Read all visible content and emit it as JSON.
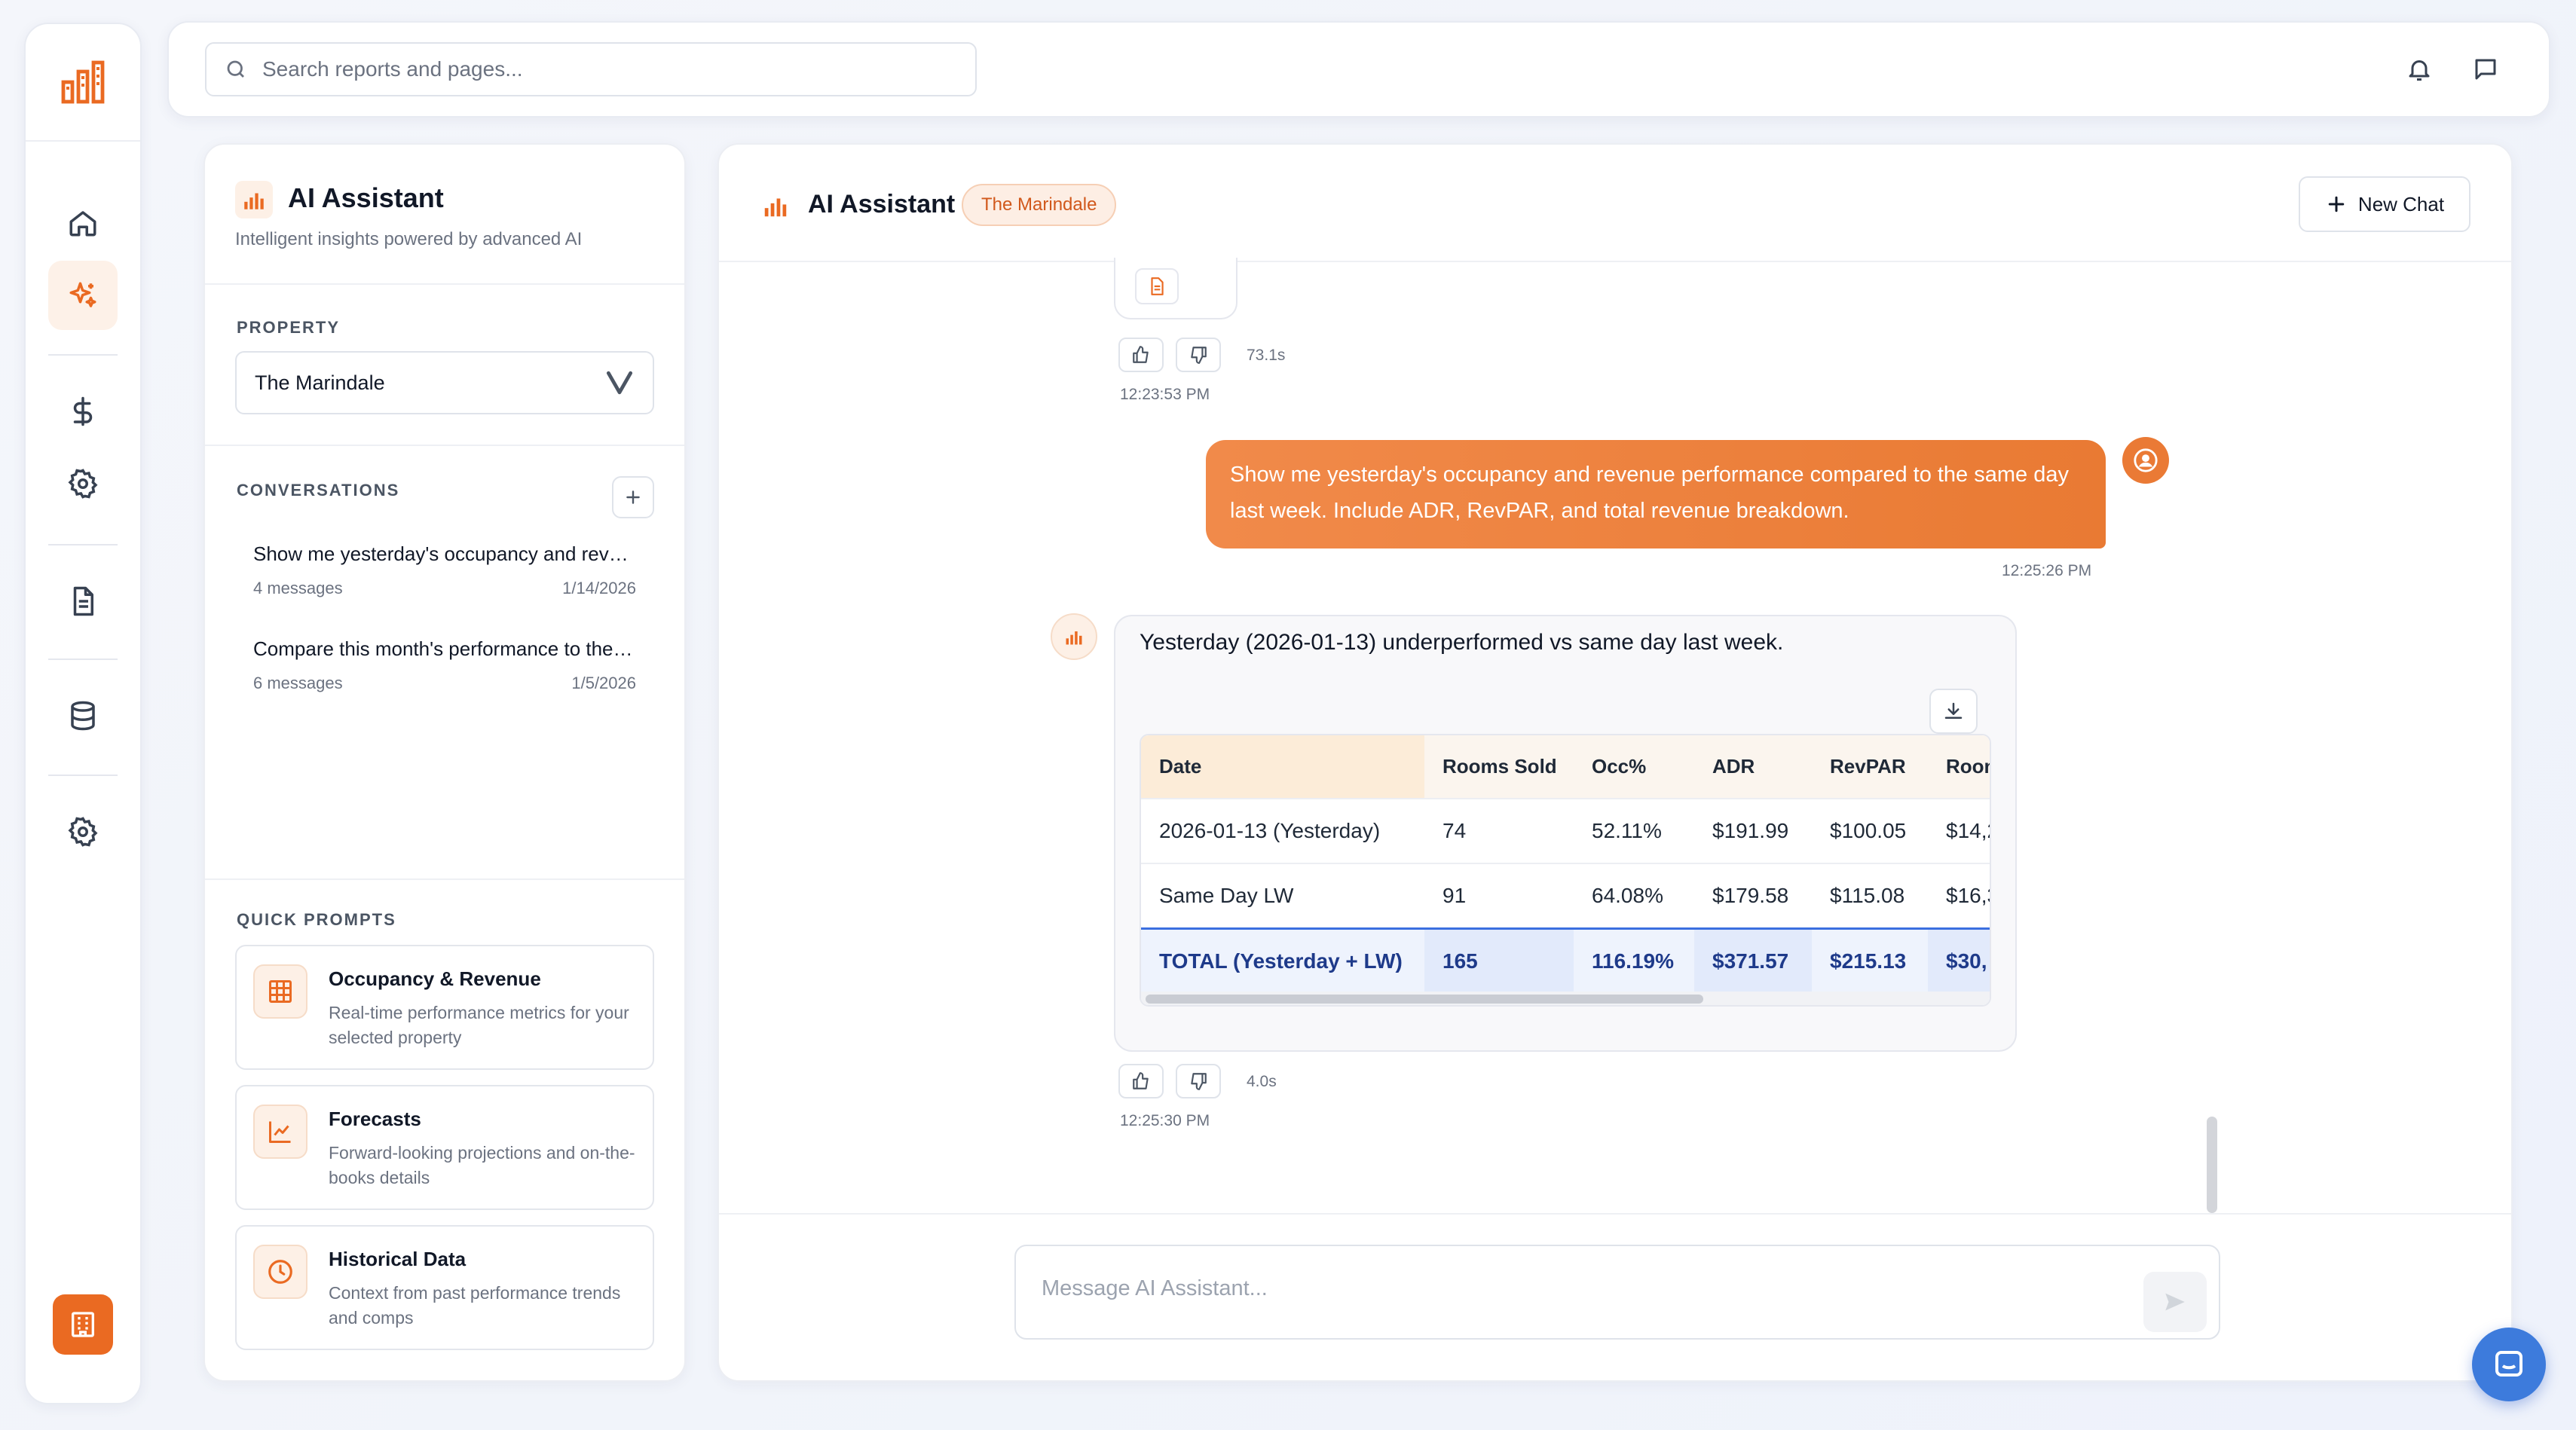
{
  "colors": {
    "accent": "#ea6a22",
    "accent_light": "#fdf0e6",
    "total_text": "#1e3a8a",
    "help": "#3d7bdc"
  },
  "topbar": {
    "search_placeholder": "Search reports and pages...",
    "icons": [
      "search-icon",
      "bell-icon",
      "chat-icon"
    ]
  },
  "rail": {
    "icons": [
      "logo-bars-icon",
      "home-icon",
      "sparkle-icon",
      "dollar-icon",
      "gear-icon",
      "document-icon",
      "database-icon",
      "gear-icon",
      "building-icon"
    ],
    "active": "sparkle-icon"
  },
  "sidebar": {
    "title": "AI Assistant",
    "subtitle": "Intelligent insights powered by advanced AI",
    "property_label": "PROPERTY",
    "property_value": "The Marindale",
    "conversations_label": "CONVERSATIONS",
    "conversations": [
      {
        "title": "Show me yesterday's occupancy and revenue performance compared to the same day last week",
        "messages": "4 messages",
        "date": "1/14/2026"
      },
      {
        "title": "Compare this month's performance to the same month last year",
        "messages": "6 messages",
        "date": "1/5/2026"
      }
    ],
    "quick_prompts_label": "QUICK PROMPTS",
    "quick_prompts": [
      {
        "title": "Occupancy & Revenue",
        "desc": "Real-time performance metrics for your selected property",
        "icon": "grid-table-icon"
      },
      {
        "title": "Forecasts",
        "desc": "Forward-looking projections and on-the-books details",
        "icon": "line-chart-icon"
      },
      {
        "title": "Historical Data",
        "desc": "Context from past performance trends and comps",
        "icon": "clock-icon"
      }
    ]
  },
  "chat": {
    "title": "AI Assistant",
    "badge": "The Marindale",
    "new_chat": "New Chat",
    "prev_message": {
      "duration": "73.1s",
      "time": "12:23:53 PM"
    },
    "user_message": {
      "text": "Show me yesterday's occupancy and revenue performance compared to the same day last week. Include ADR, RevPAR, and total revenue breakdown.",
      "time": "12:25:26 PM"
    },
    "ai_message": {
      "text": "Yesterday (2026-01-13) underperformed vs same day last week.",
      "duration": "4.0s",
      "time": "12:25:30 PM",
      "table": {
        "headers": [
          "Date",
          "Rooms Sold",
          "Occ%",
          "ADR",
          "RevPAR",
          "Roon"
        ],
        "rows": [
          [
            "2026-01-13 (Yesterday)",
            "74",
            "52.11%",
            "$191.99",
            "$100.05",
            "$14,2"
          ],
          [
            "Same Day LW",
            "91",
            "64.08%",
            "$179.58",
            "$115.08",
            "$16,3"
          ]
        ],
        "total": [
          "TOTAL (Yesterday + LW)",
          "165",
          "116.19%",
          "$371.57",
          "$215.13",
          "$30,"
        ]
      }
    },
    "composer_placeholder": "Message AI Assistant..."
  }
}
